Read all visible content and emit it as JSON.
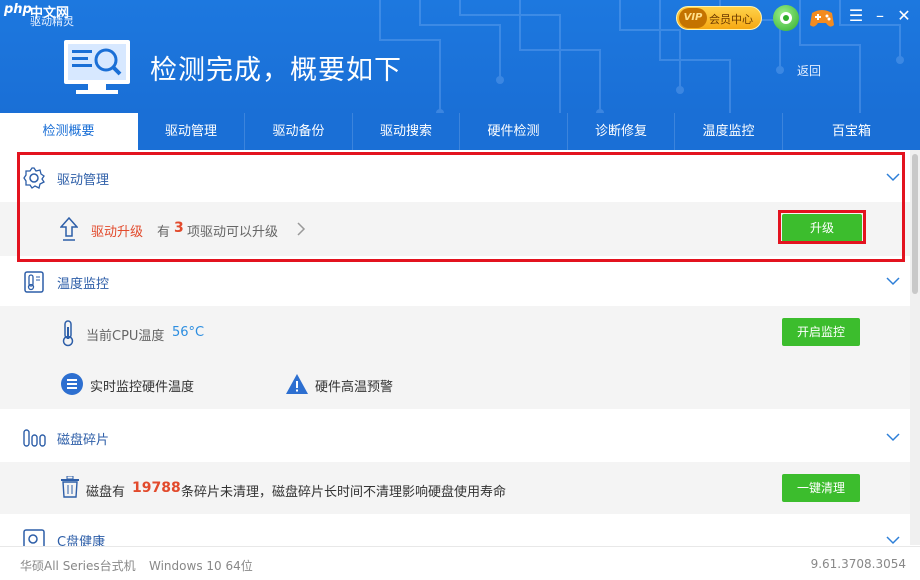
{
  "window": {
    "logo_php": "php",
    "logo_site": "中文网",
    "app_title": "驱动精灵",
    "vip_badge": "VIP",
    "vip_label": "会员中心"
  },
  "header": {
    "heading": "检测完成，概要如下",
    "back": "返回"
  },
  "tabs": [
    {
      "label": "检测概要",
      "active": true
    },
    {
      "label": "驱动管理"
    },
    {
      "label": "驱动备份"
    },
    {
      "label": "驱动搜索"
    },
    {
      "label": "硬件检测"
    },
    {
      "label": "诊断修复"
    },
    {
      "label": "温度监控"
    },
    {
      "label": "百宝箱"
    }
  ],
  "sections": {
    "driver": {
      "title": "驱动管理",
      "upgrade_title": "驱动升级",
      "upgrade_prefix": "有",
      "upgrade_count": "3",
      "upgrade_suffix": "项驱动可以升级",
      "button": "升级"
    },
    "temp": {
      "title": "温度监控",
      "cpu_prefix": "当前CPU温度",
      "cpu_value": "56°C",
      "button": "开启监控",
      "feature1": "实时监控硬件温度",
      "feature2": "硬件高温预警"
    },
    "disk": {
      "title": "磁盘碎片",
      "prefix": "磁盘有",
      "count": "19788",
      "suffix": "条碎片未清理，磁盘碎片长时间不清理影响硬盘使用寿命",
      "button": "一键清理"
    },
    "cdisk": {
      "title": "C盘健康"
    }
  },
  "footer": {
    "model": "华硕All Series台式机",
    "os": "Windows 10 64位",
    "version": "9.61.3708.3054"
  },
  "colors": {
    "header_blue": "#1a6fd6",
    "green_button": "#3cbd2d",
    "highlight_red": "#e3131f",
    "accent_orange": "#e24a2c"
  }
}
